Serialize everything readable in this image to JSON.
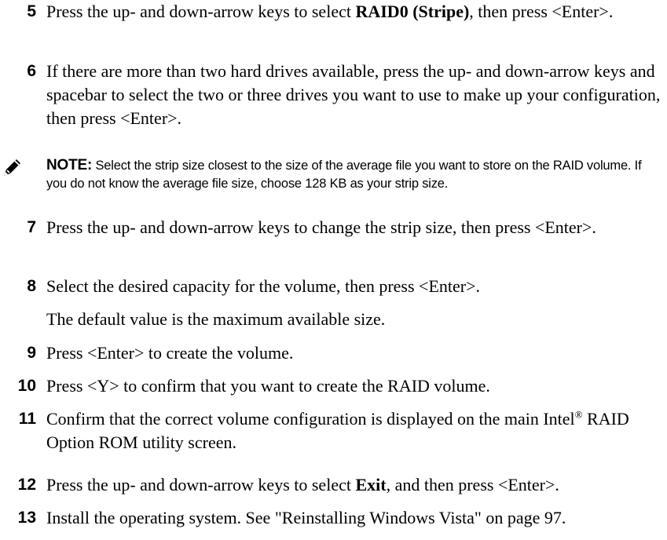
{
  "steps": [
    {
      "number": "5",
      "pre": "Press the up- and down-arrow keys to select ",
      "bold": "RAID0 (Stripe)",
      "post": ", then press <Enter>."
    },
    {
      "number": "6",
      "text": "If there are more than two hard drives available, press the up- and down-arrow keys and spacebar to select the two or three drives you want to use to make up your configuration, then press <Enter>."
    },
    {
      "number": "7",
      "text": "Press the up- and down-arrow keys to change the strip size, then press <Enter>."
    },
    {
      "number": "8",
      "text": "Select the desired capacity for the volume, then press <Enter>.",
      "subtext": "The default value is the maximum available size."
    },
    {
      "number": "9",
      "text": "Press <Enter> to create the volume."
    },
    {
      "number": "10",
      "text": "Press <Y> to confirm that you want to create the RAID volume."
    },
    {
      "number": "11",
      "pre": "Confirm that the correct volume configuration is displayed on the main Intel",
      "sup": "®",
      "post": " RAID Option ROM utility screen."
    },
    {
      "number": "12",
      "pre": "Press the up- and down-arrow keys to select ",
      "bold": "Exit",
      "post": ", and then press <Enter>."
    },
    {
      "number": "13",
      "text": "Install the operating system. See \"Reinstalling Windows Vista\" on page 97."
    }
  ],
  "note": {
    "label": "NOTE:",
    "text": " Select the strip size closest to the size of the average file you want to store on the RAID volume. If you do not know the average file size, choose 128 KB as your strip size.",
    "icon": "note-pencil-icon"
  }
}
